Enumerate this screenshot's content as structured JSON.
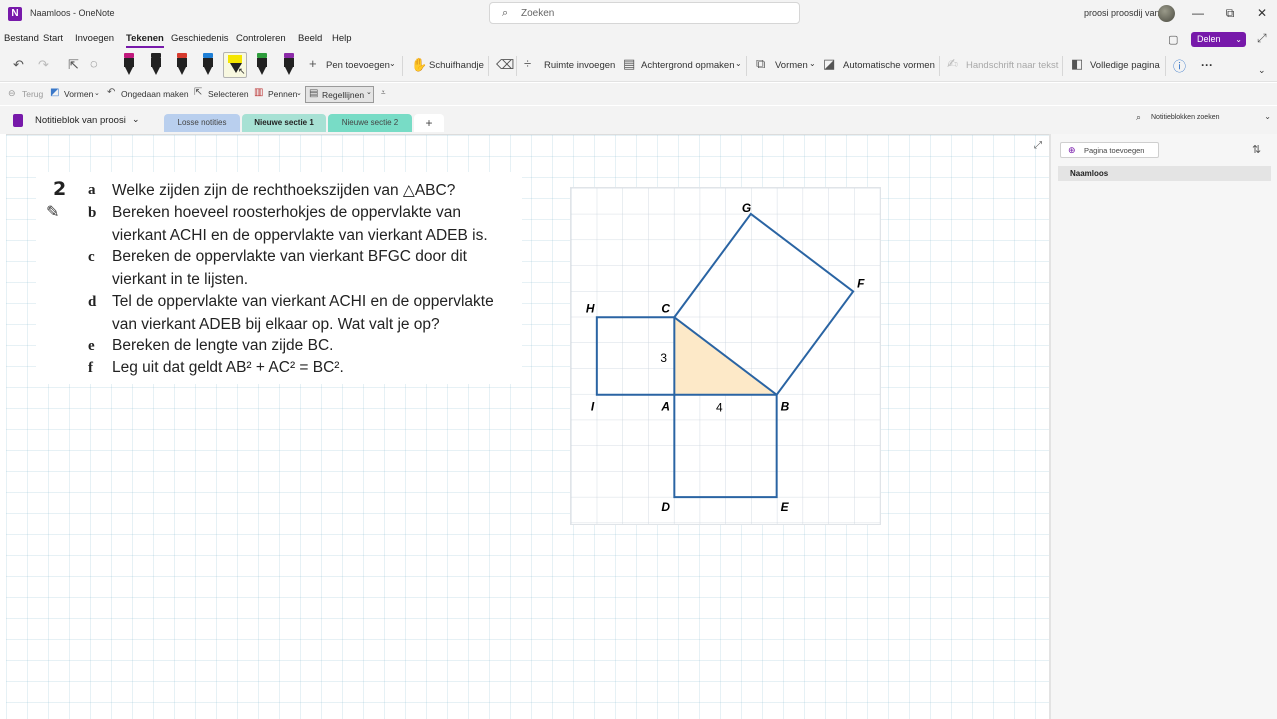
{
  "titlebar": {
    "doc_title": "Naamloos  -  OneNote",
    "search_placeholder": "Zoeken",
    "user_name": "proosi proosdij van",
    "minimize": "—",
    "restore": "⧉",
    "close": "✕"
  },
  "menu": {
    "tabs": [
      "Bestand",
      "Start",
      "Invoegen",
      "Tekenen",
      "Geschiedenis",
      "Controleren",
      "Beeld",
      "Help"
    ],
    "active": "Tekenen",
    "share_label": "Delen"
  },
  "ribbon": {
    "add_pen": "Pen toevoegen",
    "hand": "Schuifhandje",
    "insert_space": "Ruimte invoegen",
    "background": "Achtergrond opmaken",
    "shapes": "Vormen",
    "auto_shapes": "Automatische vormen",
    "ink_to_text": "Handschrift naar tekst",
    "full_page": "Volledige pagina",
    "more": "···",
    "pen_colors": [
      "#c0187c",
      "#222222",
      "#d63a2e",
      "#1e7fd6",
      "#f5e600",
      "#2e9d3c",
      "#8c2aa8"
    ]
  },
  "toolbar2": {
    "back": "Terug",
    "shapes": "Vormen",
    "undo": "Ongedaan maken",
    "select": "Selecteren",
    "pens": "Pennen",
    "rule_lines": "Regellijnen"
  },
  "sections": {
    "notebook": "Notitieblok van proosi",
    "tabs": [
      "Losse notities",
      "Nieuwe sectie 1",
      "Nieuwe sectie 2"
    ],
    "add": "+",
    "search": "Notitieblokken zoeken"
  },
  "exercise": {
    "number": "2",
    "questions": [
      {
        "letter": "a",
        "lines": [
          "Welke zijden zijn de rechthoekszijden van △ABC?"
        ]
      },
      {
        "letter": "b",
        "lines": [
          "Bereken hoeveel roosterhokjes de oppervlakte van",
          "vierkant ACHI en de oppervlakte van vierkant ADEB is."
        ]
      },
      {
        "letter": "c",
        "lines": [
          "Bereken de oppervlakte van vierkant BFGC door dit",
          "vierkant in te lijsten."
        ]
      },
      {
        "letter": "d",
        "lines": [
          "Tel de oppervlakte van vierkant ACHI en de oppervlakte",
          "van vierkant ADEB bij elkaar op. Wat valt je op?"
        ]
      },
      {
        "letter": "e",
        "lines": [
          "Bereken de lengte van zijde BC."
        ]
      },
      {
        "letter": "f",
        "lines": [
          "Leg uit dat geldt AB² + AC² = BC²."
        ]
      }
    ]
  },
  "figure": {
    "labels": {
      "G": "G",
      "F": "F",
      "H": "H",
      "C": "C",
      "I": "I",
      "A": "A",
      "B": "B",
      "D": "D",
      "E": "E"
    },
    "side_ac": "3",
    "side_ab": "4",
    "triangle_fill": "#fde9c8",
    "line_color": "#2a64a3"
  },
  "rightpane": {
    "add_page": "Pagina toevoegen",
    "pages": [
      "Naamloos"
    ]
  }
}
